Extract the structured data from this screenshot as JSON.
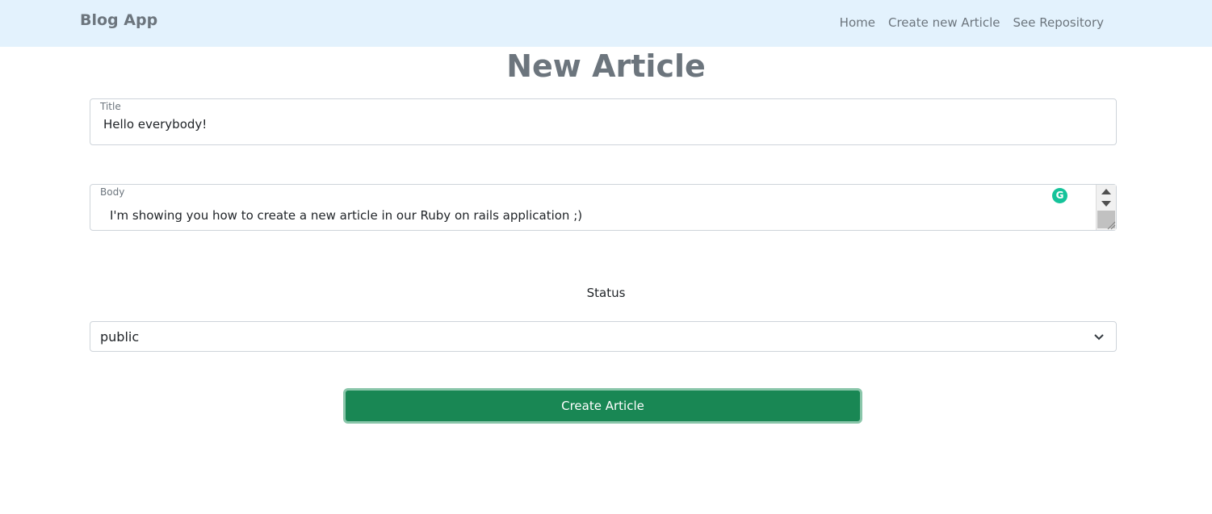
{
  "navbar": {
    "brand": "Blog App",
    "links": [
      "Home",
      "Create new Article",
      "See Repository"
    ]
  },
  "page": {
    "title": "New Article"
  },
  "form": {
    "title_label": "Title",
    "title_value": "Hello everybody!",
    "body_label": "Body",
    "body_value": "I'm showing you how to create a new article in our Ruby on rails application ;)",
    "grammarly_glyph": "G",
    "status_label": "Status",
    "status_value": "public",
    "submit_label": "Create Article"
  },
  "icons": {
    "grammarly": "grammarly-icon",
    "select_arrow": "chevron-down-icon",
    "scroll_up": "scroll-up-icon",
    "scroll_down": "scroll-down-icon",
    "resize": "resize-handle-icon"
  },
  "colors": {
    "navbar_bg": "#e3f2fd",
    "brand_text": "#6c757d",
    "submit_bg": "#198754",
    "grammarly": "#15c39a"
  }
}
